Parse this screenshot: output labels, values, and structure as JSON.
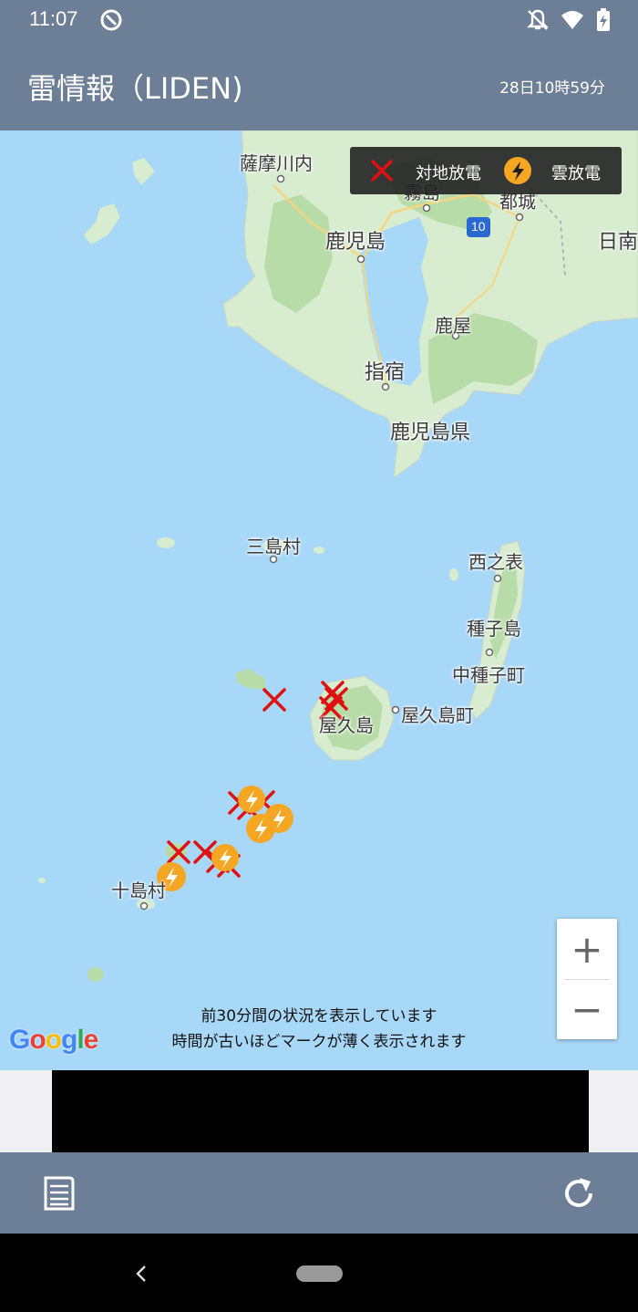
{
  "status_bar": {
    "time": "11:07",
    "icons": [
      "sync-icon",
      "notifications-off-icon",
      "wifi-icon",
      "battery-charging-icon"
    ]
  },
  "app_bar": {
    "title": "雷情報（LIDEN)",
    "updated_time": "28日10時59分"
  },
  "legend": {
    "ground_label": "対地放電",
    "cloud_label": "雲放電",
    "ground_color": "#e01010",
    "cloud_color": "#f5a623"
  },
  "map": {
    "places": [
      "薩摩川内",
      "霧島",
      "都城",
      "鹿児島",
      "日南",
      "鹿屋",
      "指宿",
      "鹿児島県",
      "三島村",
      "西之表",
      "種子島",
      "中種子町",
      "屋久島",
      "屋久島町",
      "十島村"
    ],
    "road_shield": "10"
  },
  "notice": {
    "line1": "前30分間の状況を表示しています",
    "line2": "時間が古いほどマークが薄く表示されます"
  },
  "zoom": {
    "in_label": "+",
    "out_label": "−"
  },
  "attribution": "Google",
  "toolbar": {
    "icons": [
      "list-icon",
      "refresh-icon"
    ]
  },
  "colors": {
    "app_bar": "#6d7f96",
    "water": "#a8d8f8",
    "land": "#d8ecd0",
    "forest": "#b8dca8"
  }
}
